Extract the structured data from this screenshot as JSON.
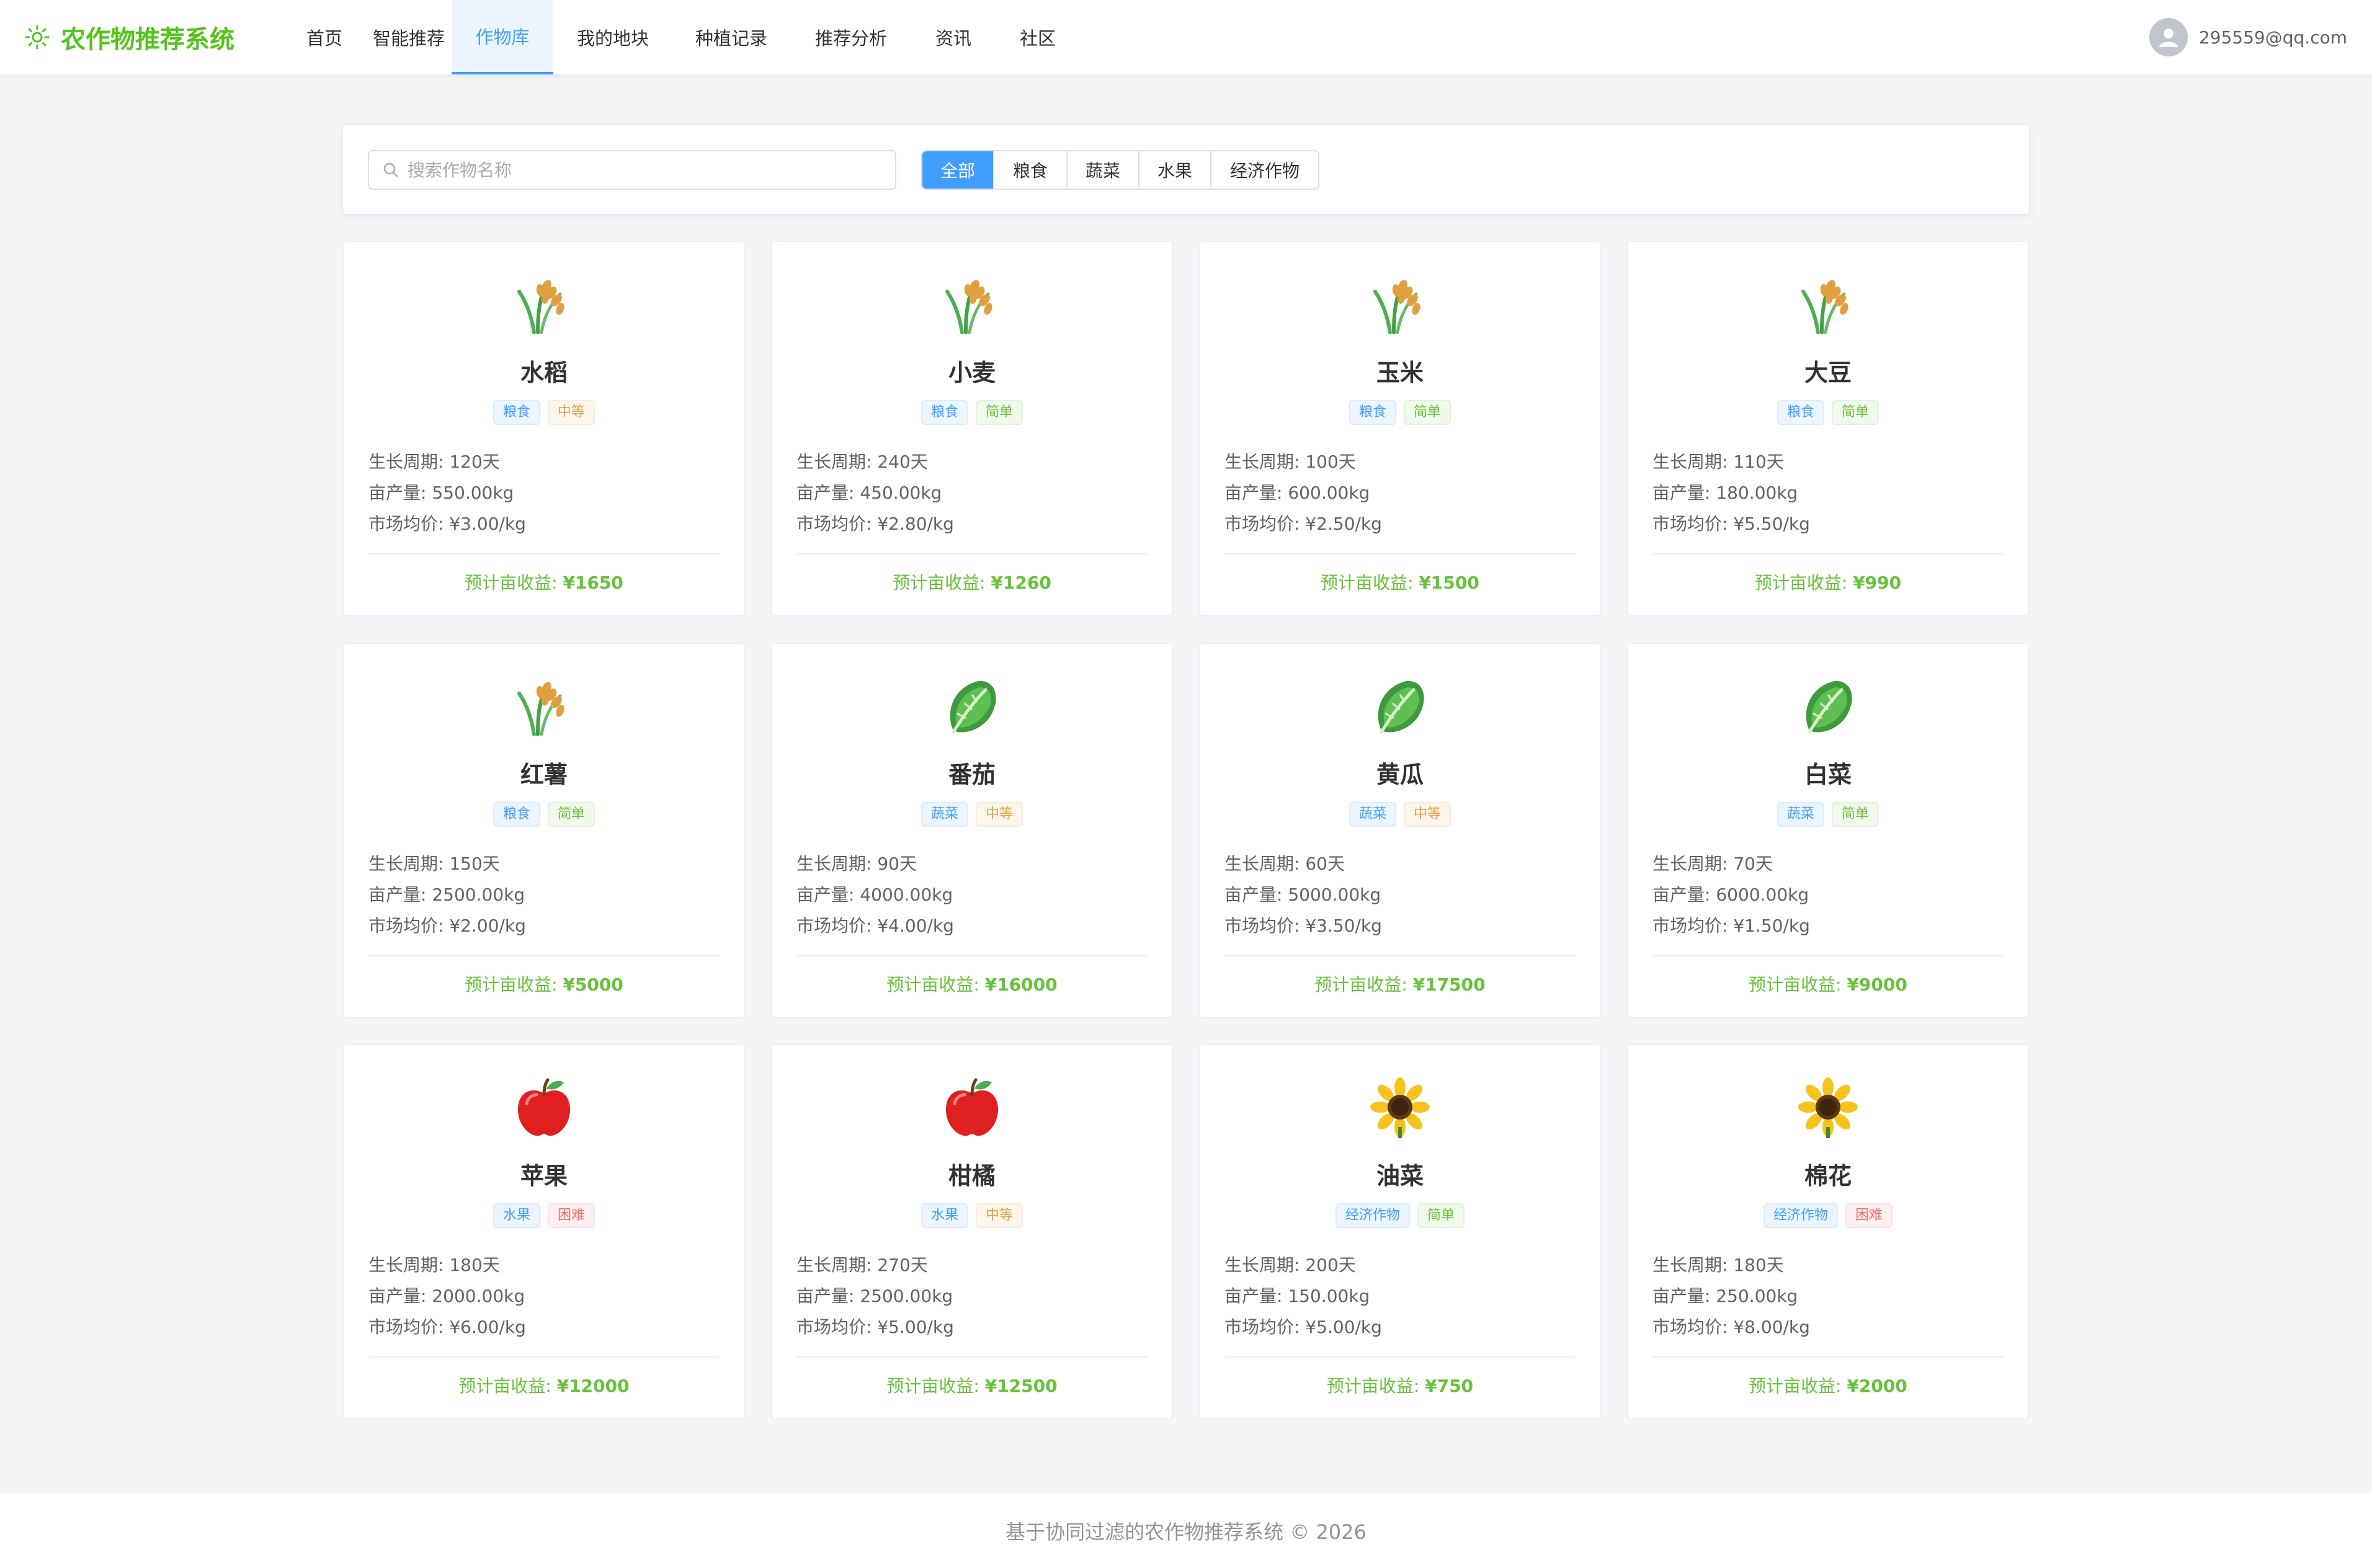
{
  "app": {
    "title": "农作物推荐系统"
  },
  "nav": {
    "items": [
      {
        "label": "首页"
      },
      {
        "label": "智能推荐"
      },
      {
        "label": "作物库",
        "active": true
      },
      {
        "label": "我的地块"
      },
      {
        "label": "种植记录"
      },
      {
        "label": "推荐分析"
      },
      {
        "label": "资讯"
      },
      {
        "label": "社区"
      }
    ]
  },
  "user": {
    "email": "295559@qq.com",
    "icon": "user-avatar-icon"
  },
  "search": {
    "placeholder": "搜索作物名称",
    "value": "",
    "icon": "search-icon"
  },
  "categories": {
    "selected": "全部",
    "options": [
      "全部",
      "粮食",
      "蔬菜",
      "水果",
      "经济作物"
    ]
  },
  "labels": {
    "growth": "生长周期: ",
    "yield": "亩产量: ",
    "price": "市场均价: ",
    "income": "预计亩收益: "
  },
  "crops": [
    {
      "name": "水稻",
      "icon": "rice-icon",
      "category": "粮食",
      "difficulty": "中等",
      "growth": "120天",
      "yield": "550.00kg",
      "price": "¥3.00/kg",
      "income": "¥1650"
    },
    {
      "name": "小麦",
      "icon": "rice-icon",
      "category": "粮食",
      "difficulty": "简单",
      "growth": "240天",
      "yield": "450.00kg",
      "price": "¥2.80/kg",
      "income": "¥1260"
    },
    {
      "name": "玉米",
      "icon": "rice-icon",
      "category": "粮食",
      "difficulty": "简单",
      "growth": "100天",
      "yield": "600.00kg",
      "price": "¥2.50/kg",
      "income": "¥1500"
    },
    {
      "name": "大豆",
      "icon": "rice-icon",
      "category": "粮食",
      "difficulty": "简单",
      "growth": "110天",
      "yield": "180.00kg",
      "price": "¥5.50/kg",
      "income": "¥990"
    },
    {
      "name": "红薯",
      "icon": "rice-icon",
      "category": "粮食",
      "difficulty": "简单",
      "growth": "150天",
      "yield": "2500.00kg",
      "price": "¥2.00/kg",
      "income": "¥5000"
    },
    {
      "name": "番茄",
      "icon": "leafy-green-icon",
      "category": "蔬菜",
      "difficulty": "中等",
      "growth": "90天",
      "yield": "4000.00kg",
      "price": "¥4.00/kg",
      "income": "¥16000"
    },
    {
      "name": "黄瓜",
      "icon": "leafy-green-icon",
      "category": "蔬菜",
      "difficulty": "中等",
      "growth": "60天",
      "yield": "5000.00kg",
      "price": "¥3.50/kg",
      "income": "¥17500"
    },
    {
      "name": "白菜",
      "icon": "leafy-green-icon",
      "category": "蔬菜",
      "difficulty": "简单",
      "growth": "70天",
      "yield": "6000.00kg",
      "price": "¥1.50/kg",
      "income": "¥9000"
    },
    {
      "name": "苹果",
      "icon": "apple-icon",
      "category": "水果",
      "difficulty": "困难",
      "growth": "180天",
      "yield": "2000.00kg",
      "price": "¥6.00/kg",
      "income": "¥12000"
    },
    {
      "name": "柑橘",
      "icon": "apple-icon",
      "category": "水果",
      "difficulty": "中等",
      "growth": "270天",
      "yield": "2500.00kg",
      "price": "¥5.00/kg",
      "income": "¥12500"
    },
    {
      "name": "油菜",
      "icon": "sunflower-icon",
      "category": "经济作物",
      "difficulty": "简单",
      "growth": "200天",
      "yield": "150.00kg",
      "price": "¥5.00/kg",
      "income": "¥750"
    },
    {
      "name": "棉花",
      "icon": "sunflower-icon",
      "category": "经济作物",
      "difficulty": "困难",
      "growth": "180天",
      "yield": "250.00kg",
      "price": "¥8.00/kg",
      "income": "¥2000"
    }
  ],
  "footer": {
    "text": "基于协同过滤的农作物推荐系统 © 2026"
  },
  "colors": {
    "brand": "#52c41a",
    "accent": "#409eff",
    "income": "#67c23a",
    "easy": "#67c23a",
    "medium": "#e6a23c",
    "hard": "#f56c6c"
  }
}
